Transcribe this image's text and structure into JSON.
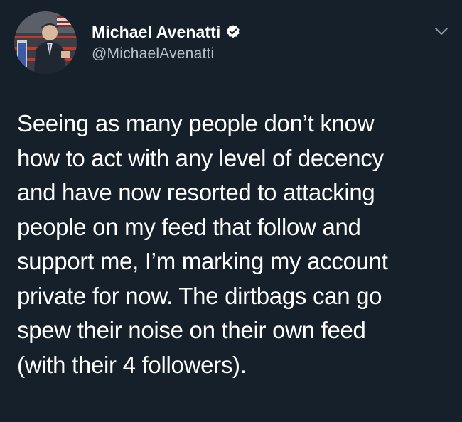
{
  "tweet": {
    "author": {
      "display_name": "Michael Avenatti",
      "handle": "@MichaelAvenatti",
      "verified": true,
      "avatar_icon": "profile-photo-icon",
      "verified_icon": "verified-badge-icon"
    },
    "menu_icon": "chevron-down-icon",
    "text_lines": [
      "Seeing as many people don’t know",
      "how to act with any level of decency",
      "and have now resorted to attacking",
      "people on my feed that follow and",
      "support me, I’m marking my account",
      "private for now. The dirtbags can go",
      "spew their noise on their own feed",
      "(with their 4 followers)."
    ]
  },
  "colors": {
    "background": "#15202b",
    "text": "#ffffff",
    "secondary_text": "#b8c0c8",
    "verified_badge": "#ffffff"
  }
}
